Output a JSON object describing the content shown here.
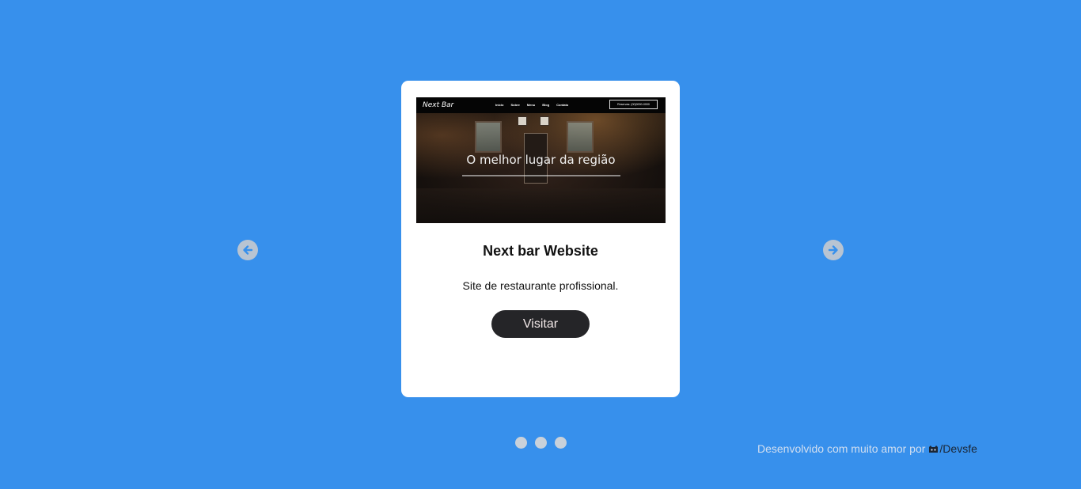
{
  "carousel": {
    "prev_icon": "arrow-left-icon",
    "next_icon": "arrow-right-icon",
    "dots_count": 3
  },
  "card": {
    "preview": {
      "brand": "Next Bar",
      "nav_links": [
        "Início",
        "Sobre",
        "Menu",
        "Blog",
        "Contato"
      ],
      "reserve_label": "Reservas: (00)0000-0000",
      "headline": "O melhor lugar da região"
    },
    "title": "Next bar Website",
    "description": "Site de restaurante profissional.",
    "visit_label": "Visitar"
  },
  "footer": {
    "text": "Desenvolvido com muito amor por",
    "link_icon": "github-icon",
    "link_label": "/Devsfe"
  },
  "colors": {
    "background": "#3790ec",
    "card": "#ffffff",
    "button": "#252528"
  }
}
